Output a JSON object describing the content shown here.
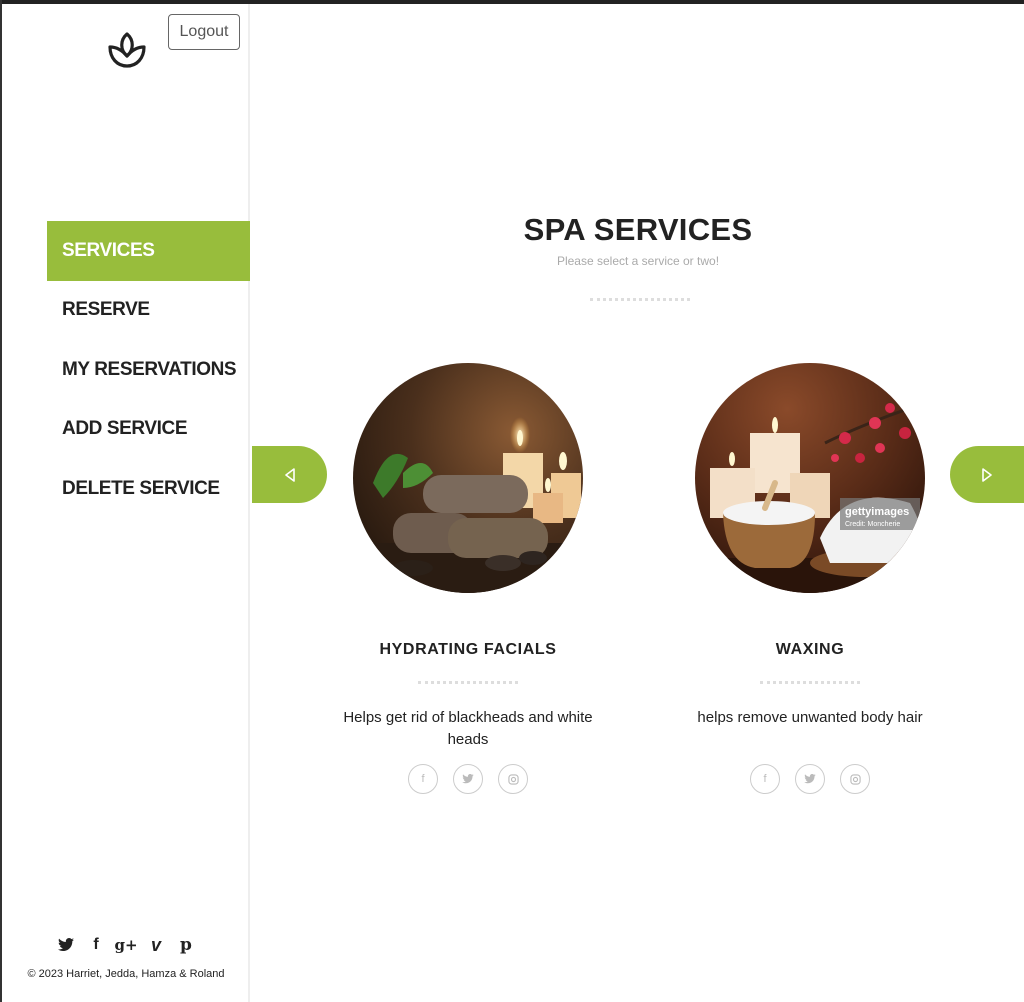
{
  "header": {
    "logout_label": "Logout"
  },
  "sidebar": {
    "nav": [
      {
        "label": "SERVICES",
        "active": true
      },
      {
        "label": "RESERVE",
        "active": false
      },
      {
        "label": "MY RESERVATIONS",
        "active": false
      },
      {
        "label": "ADD SERVICE",
        "active": false
      },
      {
        "label": "DELETE SERVICE",
        "active": false
      }
    ],
    "social_icons": [
      "twitter-icon",
      "facebook-icon",
      "google-plus-icon",
      "vimeo-icon",
      "pinterest-icon"
    ],
    "social_glyphs": {
      "twitter": "🐦",
      "facebook": "f",
      "google_plus": "g+",
      "vimeo": "v",
      "pinterest": "p"
    },
    "copyright": "© 2023 Harriet, Jedda, Hamza & Roland"
  },
  "main": {
    "title": "SPA SERVICES",
    "subtitle": "Please select a service or two!",
    "services": [
      {
        "name": "HYDRATING FACIALS",
        "description": "Helps get rid of blackheads and white heads",
        "image": "rolled-towels-candles-photo",
        "icons": [
          "facebook-icon",
          "twitter-icon",
          "instagram-icon"
        ]
      },
      {
        "name": "WAXING",
        "description": "helps remove unwanted body hair",
        "image": "salt-bowl-candles-orchid-photo",
        "watermark": "gettyimages",
        "watermark_credit": "Credit: Moncherie",
        "icons": [
          "facebook-icon",
          "twitter-icon",
          "instagram-icon"
        ]
      }
    ]
  },
  "colors": {
    "accent": "#98bd3c",
    "text": "#222222",
    "muted": "#aaaaaa"
  }
}
